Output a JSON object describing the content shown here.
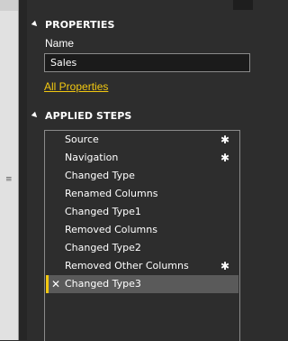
{
  "properties": {
    "header": "PROPERTIES",
    "name_label": "Name",
    "name_value": "Sales",
    "all_properties_link": "All Properties"
  },
  "applied_steps": {
    "header": "APPLIED STEPS",
    "items": [
      {
        "label": "Source",
        "has_settings": true
      },
      {
        "label": "Navigation",
        "has_settings": true
      },
      {
        "label": "Changed Type",
        "has_settings": false
      },
      {
        "label": "Renamed Columns",
        "has_settings": false
      },
      {
        "label": "Changed Type1",
        "has_settings": false
      },
      {
        "label": "Removed Columns",
        "has_settings": false
      },
      {
        "label": "Changed Type2",
        "has_settings": false
      },
      {
        "label": "Removed Other Columns",
        "has_settings": true
      },
      {
        "label": "Changed Type3",
        "has_settings": false,
        "selected": true
      }
    ]
  },
  "icons": {
    "settings": "gear-icon",
    "delete": "close-icon",
    "collapse": "triangle-collapse-icon"
  },
  "colors": {
    "background": "#2d2d2d",
    "accent": "#f2c811",
    "selected_row": "#5a5a5a"
  }
}
